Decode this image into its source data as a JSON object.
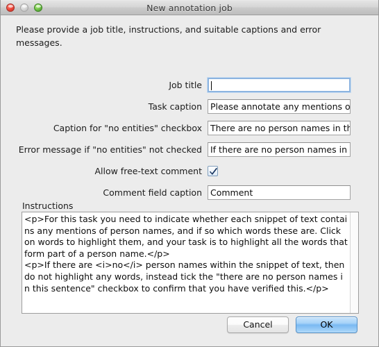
{
  "window": {
    "title": "New annotation job",
    "traffic_lights": [
      {
        "name": "close-button",
        "color": "#ef4a3c"
      },
      {
        "name": "minimize-button",
        "color": "#d7d7d7"
      },
      {
        "name": "zoom-button",
        "color": "#74c44a"
      }
    ]
  },
  "intro": "Please provide a job title, instructions, and suitable captions and error messages.",
  "form": {
    "rows": [
      {
        "label": "Job title",
        "value": "",
        "type": "text",
        "focused": true
      },
      {
        "label": "Task caption",
        "value": "Please annotate any mentions o",
        "type": "text",
        "focused": false
      },
      {
        "label": "Caption for \"no entities\" checkbox",
        "value": "There are no person names in th",
        "type": "text",
        "focused": false
      },
      {
        "label": "Error message if \"no entities\" not checked",
        "value": "If there are no person names in",
        "type": "text",
        "focused": false
      },
      {
        "label": "Allow free-text comment",
        "value": "",
        "type": "checkbox",
        "checked": true
      },
      {
        "label": "Comment field caption",
        "value": "Comment",
        "type": "text",
        "focused": false
      }
    ]
  },
  "instructions": {
    "label": "Instructions",
    "value": "<p>For this task you need to indicate whether each snippet of text contains any mentions of person names, and if so which words these are. Click on words to highlight them, and your task is to highlight all the words that form part of a person name.</p>\n<p>If there are <i>no</i> person names within the snippet of text, then do not highlight any words, instead tick the \"there are no person names in this sentence\" checkbox to confirm that you have verified this.</p>"
  },
  "buttons": {
    "cancel": "Cancel",
    "ok": "OK"
  },
  "colors": {
    "window_background": "#ececec",
    "focus_border": "#8cb4e0",
    "ok_accent": "#7ab9f2",
    "checkbox_border": "#7f9dbb"
  }
}
